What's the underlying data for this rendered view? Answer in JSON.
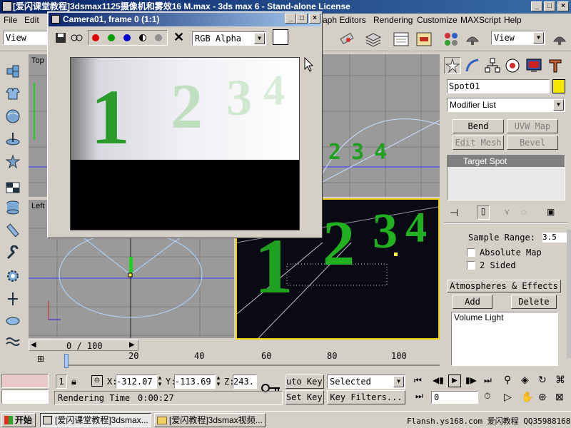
{
  "window": {
    "title": "[爱闪课堂教程]3dsmax1125摄像机和雾效16  M.max - 3ds max 6 - Stand-alone License",
    "min_label": "_",
    "max_label": "□",
    "close_label": "×"
  },
  "menu": {
    "file": "File",
    "edit": "Edit",
    "graph_editors": "aph Editors",
    "rendering": "Rendering",
    "customize": "Customize",
    "maxscript": "MAXScript",
    "help": "Help"
  },
  "toolbar": {
    "view_left": "View",
    "view_right": "View"
  },
  "viewports": {
    "top": "Top",
    "left": "Left"
  },
  "frame_window": {
    "title": "Camera01, frame 0 (1:1)",
    "channel": "RGB Alpha",
    "min_label": "_",
    "max_label": "□",
    "close_label": "×",
    "numbers": [
      "1",
      "2",
      "3",
      "4"
    ],
    "clear_label": "✕"
  },
  "top_viewport_numbers": [
    "2",
    "3",
    "4"
  ],
  "cmd_panel": {
    "object_name": "Spot01",
    "object_color": "#f5e600",
    "modifier_list": "Modifier List",
    "buttons": {
      "bend": "Bend",
      "uvw_map": "UVW Map",
      "edit_mesh": "Edit Mesh",
      "bevel": "Bevel"
    },
    "stack_item": "Target Spot",
    "sample_range_label": "Sample Range:",
    "sample_range_value": "3.5",
    "absolute_map": "Absolute Map",
    "two_sided": "2 Sided",
    "atmos_title": "Atmospheres & Effects",
    "add": "Add",
    "delete": "Delete",
    "effects": [
      "Volume Light"
    ]
  },
  "timeline": {
    "frame_counter": "0 / 100",
    "ticks": [
      "0",
      "20",
      "40",
      "60",
      "80",
      "100"
    ]
  },
  "status": {
    "selection_count": "1",
    "x_label": "X:",
    "x_value": "-312.07",
    "y_label": "Y:",
    "y_value": "-113.69",
    "z_label": "Z:",
    "z_value": "243.",
    "auto_key": "uto Key",
    "selected": "Selected",
    "set_key": "Set Key",
    "key_filters": "Key Filters...",
    "rendering_time_label": "Rendering Time",
    "rendering_time": "0:00:27",
    "current_frame": "0"
  },
  "taskbar": {
    "start": "开始",
    "task1": "[爱闪课堂教程]3dsmax...",
    "task2": "[爱闪教程]3dsmax视频...",
    "watermark": "Flansh.ys168.com 爱闪教程 QQ359881688"
  }
}
